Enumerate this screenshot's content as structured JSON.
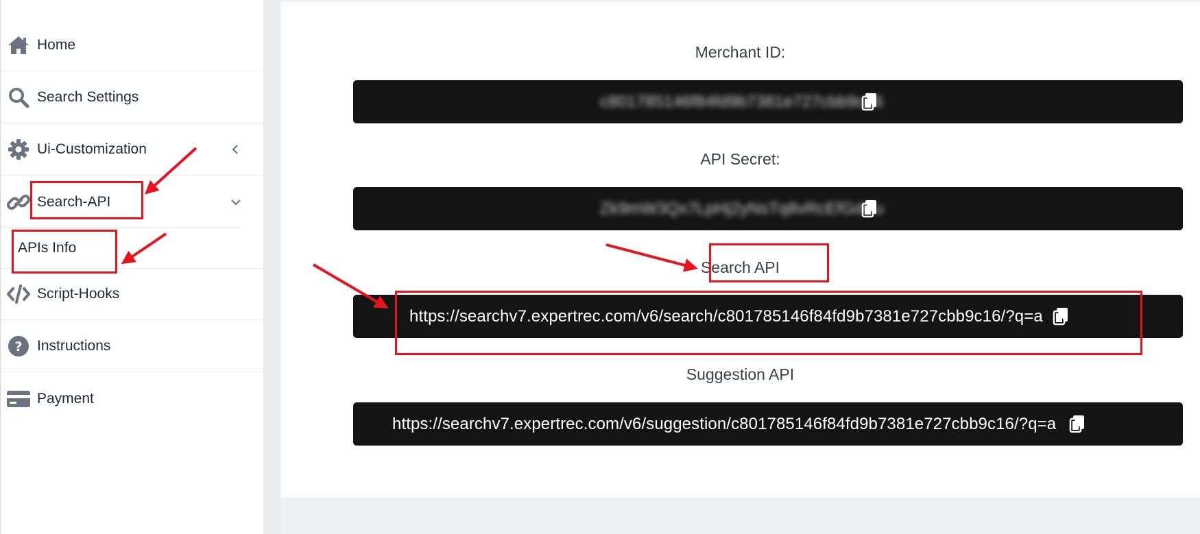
{
  "sidebar": {
    "items": [
      {
        "label": "Home",
        "icon": "home-icon"
      },
      {
        "label": "Search Settings",
        "icon": "search-icon"
      },
      {
        "label": "Ui-Customization",
        "icon": "gear-icon",
        "chevron": "chevron-left-icon"
      },
      {
        "label": "Search-API",
        "icon": "link-icon",
        "chevron": "chevron-down-icon"
      },
      {
        "label": "Script-Hooks",
        "icon": "code-icon"
      },
      {
        "label": "Instructions",
        "icon": "question-circle-icon"
      },
      {
        "label": "Payment",
        "icon": "credit-card-icon"
      }
    ],
    "subitem": {
      "label": "APIs Info"
    }
  },
  "main": {
    "merchant_id": {
      "label": "Merchant ID:",
      "value": "c801785146f84fd9b7381e727cbb9c16"
    },
    "api_secret": {
      "label": "API Secret:",
      "value": "Zk9mW3Qx7LpHj2yNsTq8vRcEfGdKu"
    },
    "search_api": {
      "label": "Search API",
      "value": "https://searchv7.expertrec.com/v6/search/c801785146f84fd9b7381e727cbb9c16/?q=a"
    },
    "suggestion_api": {
      "label": "Suggestion API",
      "value": "https://searchv7.expertrec.com/v6/suggestion/c801785146f84fd9b7381e727cbb9c16/?q=a"
    }
  },
  "colors": {
    "accent_annotation": "#e8131c",
    "bar_background": "#141414",
    "icon_gray": "#6b7280"
  }
}
